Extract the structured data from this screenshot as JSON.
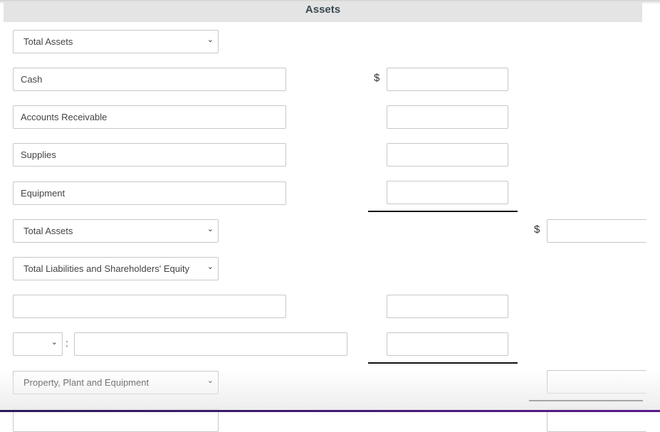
{
  "header": {
    "title": "Assets"
  },
  "rows": {
    "total_assets_select": "Total Assets",
    "cash": "Cash",
    "accounts_receivable": "Accounts Receivable",
    "supplies": "Supplies",
    "equipment": "Equipment",
    "total_assets_select2": "Total Assets",
    "total_liab_select": "Total Liabilities and Shareholders' Equity",
    "blank_label": "",
    "small_select": "",
    "colon": ":",
    "ppe_select": "Property, Plant and Equipment"
  },
  "symbols": {
    "dollar": "$",
    "chevron": "⌄"
  },
  "amounts": {
    "cash": "",
    "accounts_receivable": "",
    "supplies": "",
    "equipment": "",
    "total_assets": "",
    "blank_row": "",
    "colon_row": "",
    "subtotal": ""
  },
  "colors": {
    "header_bg": "#e4e4e4",
    "border": "#c8c8c8",
    "accent_bar": "#4a1a7a"
  }
}
